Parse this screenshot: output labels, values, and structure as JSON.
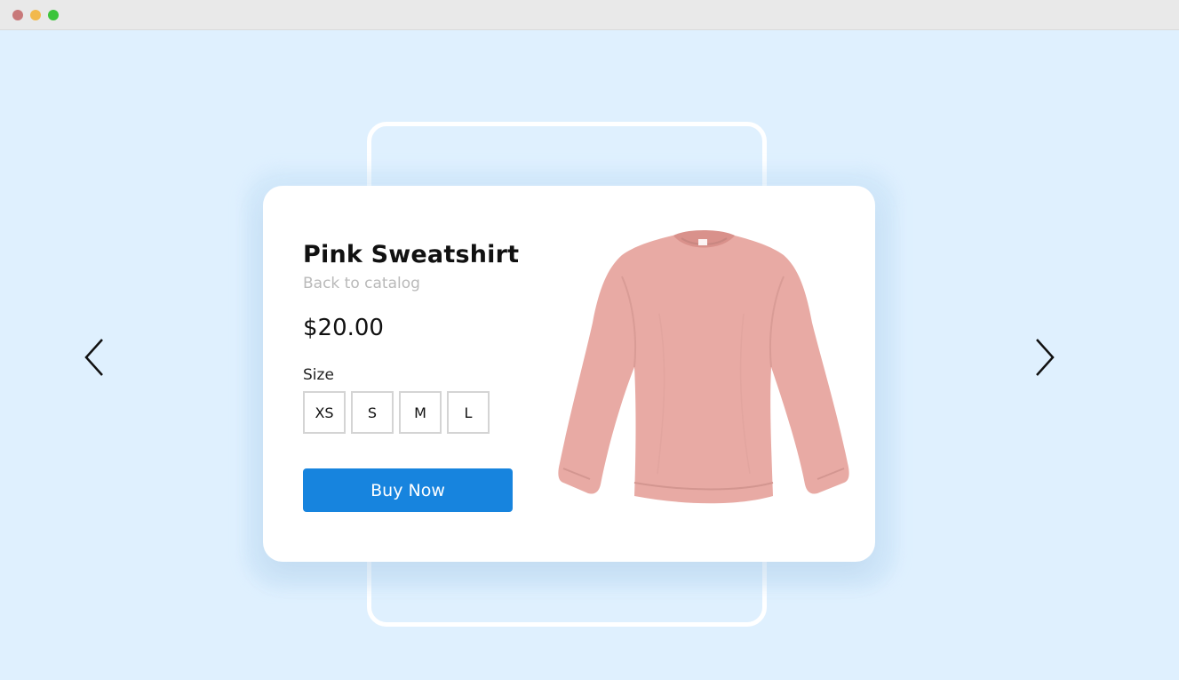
{
  "window": {
    "controls": {
      "close_color": "#c8797a",
      "minimize_color": "#f2b94d",
      "maximize_color": "#3cc43c"
    }
  },
  "colors": {
    "background": "#dff0fe",
    "accent": "#1784de",
    "sweatshirt": "#e8aaa4"
  },
  "product": {
    "title": "Pink Sweatshirt",
    "back_link": "Back to catalog",
    "price": "$20.00",
    "size_label": "Size",
    "sizes": [
      "XS",
      "S",
      "M",
      "L"
    ],
    "buy_label": "Buy Now",
    "image_icon": "sweatshirt-image"
  },
  "carousel": {
    "prev_icon": "chevron-left-icon",
    "next_icon": "chevron-right-icon"
  }
}
